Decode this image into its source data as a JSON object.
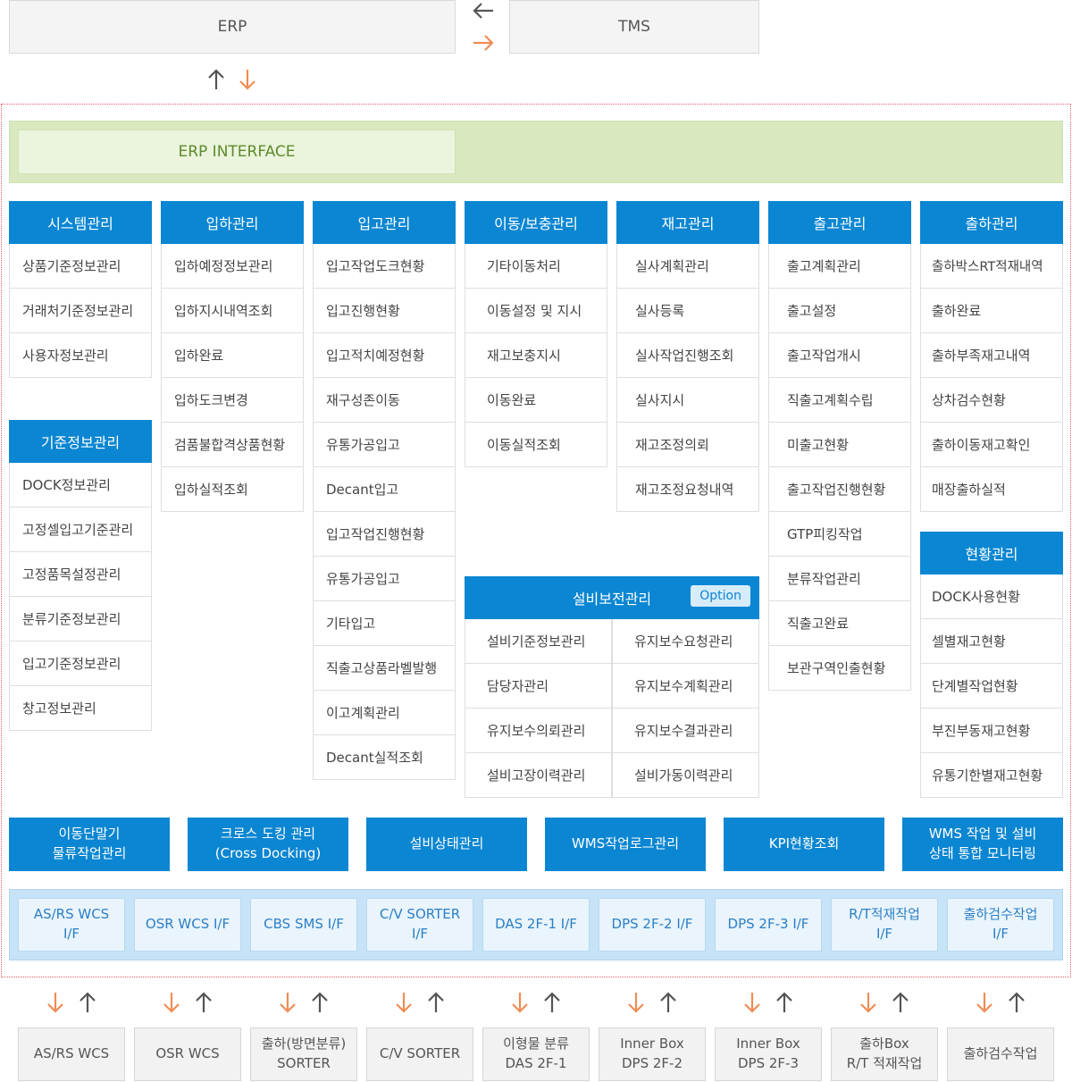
{
  "top": {
    "erp": "ERP",
    "tms": "TMS"
  },
  "interface": {
    "label": "ERP INTERFACE"
  },
  "colors": {
    "blue": "#0b86d2",
    "orange": "#f08c55",
    "gray_arrow": "#555555",
    "green_text": "#5d8b2d",
    "dotted_border": "#e35a6a"
  },
  "columns": [
    {
      "title": "시스템관리",
      "items": [
        "상품기준정보관리",
        "거래처기준정보관리",
        "사용자정보관리"
      ]
    },
    {
      "title": "입하관리",
      "items": [
        "입하예정정보관리",
        "입하지시내역조회",
        "입하완료",
        "입하도크변경",
        "검품불합격상품현황",
        "입하실적조회"
      ]
    },
    {
      "title": "입고관리",
      "items": [
        "입고작업도크현황",
        "입고진행현황",
        "입고적치예정현황",
        "재구성존이동",
        "유통가공입고",
        "Decant입고",
        "입고작업진행현황",
        "유통가공입고",
        "기타입고",
        "직출고상품라벨발행",
        "이고계획관리",
        "Decant실적조회"
      ]
    },
    {
      "title": "이동/보충관리",
      "items": [
        "기타이동처리",
        "이동설정 및 지시",
        "재고보충지시",
        "이동완료",
        "이동실적조회"
      ]
    },
    {
      "title": "재고관리",
      "items": [
        "실사계획관리",
        "실사등록",
        "실사작업진행조회",
        "실사지시",
        "재고조정의뢰",
        "재고조정요청내역"
      ]
    },
    {
      "title": "출고관리",
      "items": [
        "출고계획관리",
        "출고설정",
        "출고작업개시",
        "직출고계획수립",
        "미출고현황",
        "출고작업진행현황",
        "GTP피킹작업",
        "분류작업관리",
        "직출고완료",
        "보관구역인출현황"
      ]
    },
    {
      "title": "출하관리",
      "items": [
        "출하박스RT적재내역",
        "출하완료",
        "출하부족재고내역",
        "상차검수현황",
        "출하이동재고확인",
        "매장출하실적"
      ]
    }
  ],
  "master": {
    "title": "기준정보관리",
    "items": [
      "DOCK정보관리",
      "고정셀입고기준관리",
      "고정품목설정관리",
      "분류기준정보관리",
      "입고기준정보관리",
      "창고정보관리"
    ]
  },
  "status": {
    "title": "현황관리",
    "items": [
      "DOCK사용현황",
      "셀별재고현황",
      "단계별작업현황",
      "부진부동재고현황",
      "유통기한별재고현황"
    ]
  },
  "facility": {
    "title": "설비보전관리",
    "option": "Option",
    "items": [
      "설비기준정보관리",
      "유지보수요청관리",
      "담당자관리",
      "유지보수계획관리",
      "유지보수의뢰관리",
      "유지보수결과관리",
      "설비고장이력관리",
      "설비가동이력관리"
    ]
  },
  "modules": [
    "이동단말기\n물류작업관리",
    "크로스 도킹 관리\n(Cross Docking)",
    "설비상태관리",
    "WMS작업로그관리",
    "KPI현황조회",
    "WMS 작업 및 설비\n상태 통합 모니터링"
  ],
  "interfaces": [
    "AS/RS WCS\nI/F",
    "OSR WCS I/F",
    "CBS SMS I/F",
    "C/V SORTER\nI/F",
    "DAS 2F-1 I/F",
    "DPS 2F-2 I/F",
    "DPS 2F-3 I/F",
    "R/T적재작업\nI/F",
    "출하검수작업\nI/F"
  ],
  "equipment": [
    "AS/RS WCS",
    "OSR WCS",
    "출하(방면분류)\nSORTER",
    "C/V SORTER",
    "이형물 분류\nDAS 2F-1",
    "Inner Box\nDPS 2F-2",
    "Inner Box\nDPS 2F-3",
    "출하Box\nR/T 적재작업",
    "출하검수작업"
  ]
}
